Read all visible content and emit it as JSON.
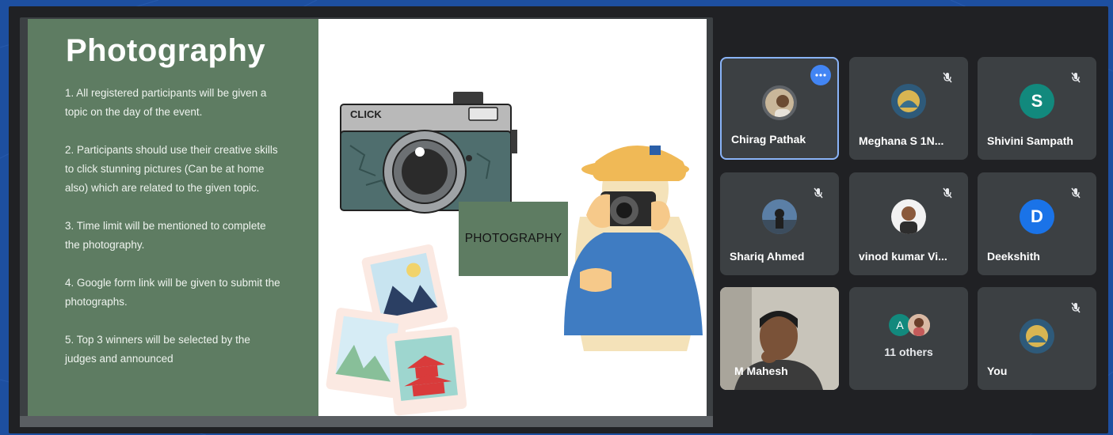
{
  "slide": {
    "title": "Photography",
    "rules": [
      "1. All registered participants will be given a topic on the day of the event.",
      "2. Participants should use their creative skills to click stunning pictures (Can be at home also) which are related to the given topic.",
      "3. Time limit will be mentioned to complete the photography.",
      "4. Google form link will be given to submit the photographs.",
      "5. Top 3 winners will be selected by the judges and announced"
    ],
    "camera_label": "CLICK",
    "box_label": "PHOTOGRAPHY",
    "colors": {
      "panel": "#5e7c62",
      "camera_body": "#4f6e6e",
      "hat": "#f0b956",
      "shirt": "#3f7cc2"
    }
  },
  "participants": [
    {
      "name": "Chirag Pathak",
      "avatar": "photo",
      "muted": false,
      "active": true,
      "menu_icon": "more-options-icon"
    },
    {
      "name": "Meghana S 1N...",
      "avatar": "photo",
      "muted": true
    },
    {
      "name": "Shivini Sampath",
      "avatar": "S",
      "avatar_color": "#12897d",
      "muted": true
    },
    {
      "name": "Shariq Ahmed",
      "avatar": "photo",
      "muted": true
    },
    {
      "name": "vinod kumar Vi...",
      "avatar": "photo",
      "muted": true
    },
    {
      "name": "Deekshith",
      "avatar": "D",
      "avatar_color": "#1a73e8",
      "muted": true
    },
    {
      "name": "M Mahesh",
      "avatar": "video",
      "muted": false
    },
    {
      "name": "11 others",
      "avatar": "A",
      "avatar_color": "#12897d",
      "muted": false
    },
    {
      "name": "You",
      "avatar": "photo",
      "muted": true
    }
  ],
  "icons": {
    "mute": "mic-off-icon",
    "more": "more-options-icon"
  }
}
